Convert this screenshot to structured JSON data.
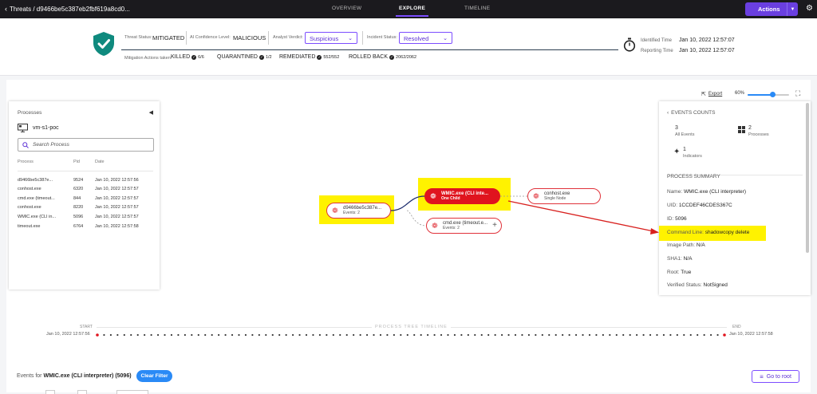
{
  "nav": {
    "back_label": "Threats / d9466be5c387eb2fbf619a8cd0...",
    "tabs": [
      {
        "label": "OVERVIEW"
      },
      {
        "label": "EXPLORE",
        "active": true
      },
      {
        "label": "TIMELINE"
      }
    ],
    "actions_label": "Actions",
    "accent": "#6a3fe0"
  },
  "header": {
    "threat_status_label": "Threat Status:",
    "threat_status": "MITIGATED",
    "ai_confidence_label": "AI Confidence Level:",
    "ai_confidence": "MALICIOUS",
    "analyst_verdict_label": "Analyst Verdict:",
    "analyst_verdict": "Suspicious",
    "incident_status_label": "Incident Status:",
    "incident_status": "Resolved",
    "mitigation_label": "Mitigation Actions taken:",
    "mitigations": [
      {
        "label": "KILLED",
        "count": "6/6"
      },
      {
        "label": "QUARANTINED",
        "count": "1/2"
      },
      {
        "label": "REMEDIATED",
        "count": "552/552"
      },
      {
        "label": "ROLLED BACK",
        "count": "2062/2062"
      }
    ],
    "identified_label": "Identified Time",
    "identified_time": "Jan 10, 2022 12:57:07",
    "reporting_label": "Reporting Time",
    "reporting_time": "Jan 10, 2022 12:57:07",
    "shield_color": "#0f8a7e"
  },
  "toolbar": {
    "export_label": "Export",
    "zoom_label": "60%",
    "zoom_level": 0.6
  },
  "processes": {
    "title": "Processes",
    "agent_name": "vm-s1-poc",
    "search_placeholder": "Search Process",
    "columns": [
      "Process",
      "Pid",
      "Date"
    ],
    "rows": [
      {
        "process": "d9466be5c387e...",
        "pid": "9524",
        "date": "Jan 10, 2022 12:57:56"
      },
      {
        "process": "conhost.exe",
        "pid": "6320",
        "date": "Jan 10, 2022 12:57:57"
      },
      {
        "process": "cmd.exe (timeout...",
        "pid": "844",
        "date": "Jan 10, 2022 12:57:57"
      },
      {
        "process": "conhost.exe",
        "pid": "8220",
        "date": "Jan 10, 2022 12:57:57"
      },
      {
        "process": "WMIC.exe (CLI in...",
        "pid": "5096",
        "date": "Jan 10, 2022 12:57:57"
      },
      {
        "process": "timeout.exe",
        "pid": "6764",
        "date": "Jan 10, 2022 12:57:58"
      }
    ]
  },
  "graph": {
    "root": {
      "label": "d9466be5c387e...",
      "sub": "Events: 2"
    },
    "wmic": {
      "label": "WMIC.exe (CLI inte...",
      "sub": "One Child"
    },
    "conhost": {
      "label": "conhost.exe",
      "sub": "Single Node"
    },
    "cmd": {
      "label": "cmd.exe (timeout.e...",
      "sub": "Events: 2"
    },
    "node_color": "#e0323a",
    "highlight_color": "#fff200"
  },
  "events_panel": {
    "counts_title": "EVENTS COUNTS",
    "all_events_count": "3",
    "all_events_label": "All Events",
    "processes_count": "2",
    "processes_label": "Processes",
    "indicators_count": "1",
    "indicators_label": "Indicators",
    "summary_title": "PROCESS SUMMARY",
    "name_label": "Name:",
    "name": "WMIC.exe (CLI interpreter)",
    "uid_label": "UID:",
    "uid": "1CCDEF46CDES367C",
    "id_label": "ID:",
    "id": "5096",
    "cmd_label": "Command Line:",
    "cmd": "shadowcopy delete",
    "image_label": "Image Path:",
    "image": "N/A",
    "sha1_label": "SHA1:",
    "sha1": "N/A",
    "root_label": "Root:",
    "root": "True",
    "verified_label": "Verified Status:",
    "verified": "NotSigned"
  },
  "timeline": {
    "start_label": "START",
    "end_label": "END",
    "title": "PROCESS TREE TIMELINE",
    "start_date": "Jan 10, 2022 12:57:56",
    "end_date": "Jan 10, 2022 12:57:58"
  },
  "bottom": {
    "events_for_prefix": "Events for",
    "events_for_name": "WMIC.exe (CLI interpreter) (5096)",
    "clear_filter": "Clear Filter",
    "go_to_root": "Go to root"
  }
}
